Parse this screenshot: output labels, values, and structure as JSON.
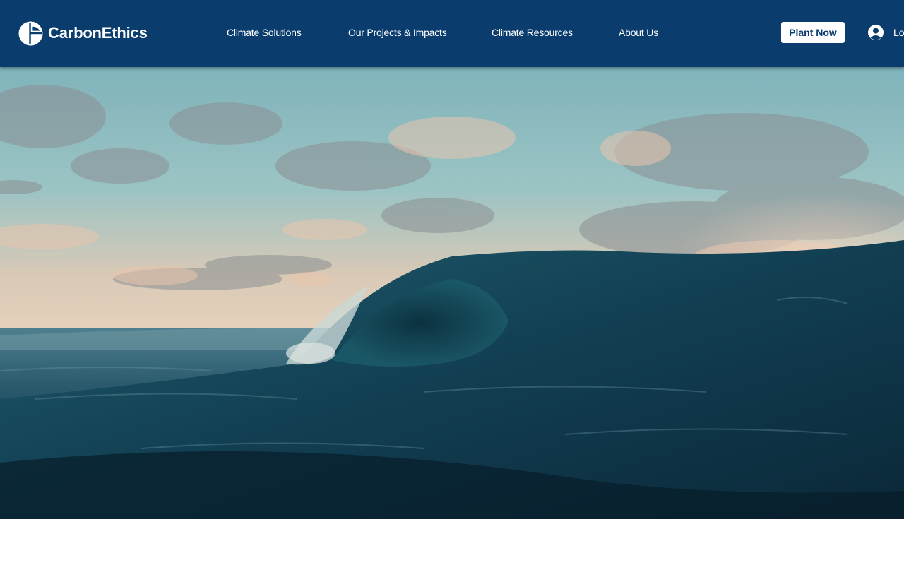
{
  "brand": {
    "name": "CarbonEthics",
    "logo_icon": "carbonethics-logo-icon"
  },
  "nav": {
    "items": [
      {
        "label": "Climate Solutions"
      },
      {
        "label": "Our Projects & Impacts"
      },
      {
        "label": "Climate Resources"
      },
      {
        "label": "About Us"
      }
    ]
  },
  "header": {
    "cta_label": "Plant Now",
    "login_label": "Lo",
    "login_icon": "user-circle-icon"
  },
  "colors": {
    "header_bg": "#0a3d6e",
    "cta_bg": "#ffffff",
    "cta_text": "#0a3d6e",
    "ocean_deep": "#0b2a3a",
    "sky_top": "#7fb6bf"
  },
  "hero": {
    "media": "ocean-wave-video"
  }
}
